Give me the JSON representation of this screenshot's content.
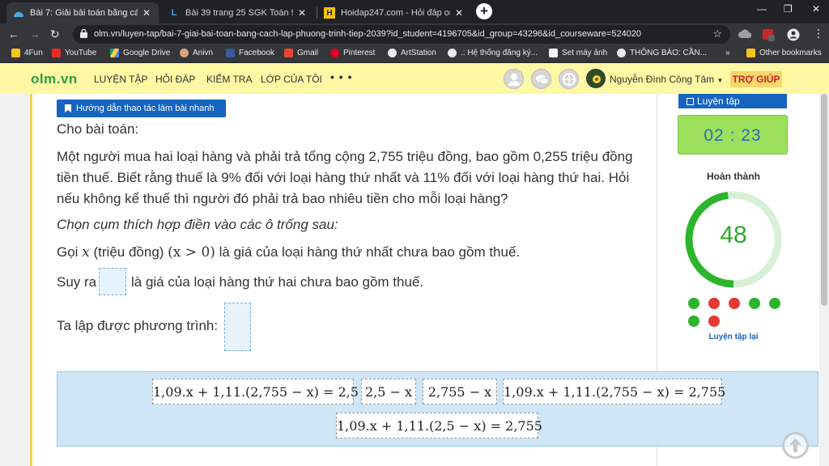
{
  "browser": {
    "tabs": [
      {
        "title": "Bài 7: Giải bài toán bằng cách lập",
        "active": true
      },
      {
        "title": "Bài 39 trang 25 SGK Toán 9 tập 2",
        "active": false
      },
      {
        "title": "Hoidap247.com - Hỏi đáp online",
        "active": false
      }
    ],
    "url": "olm.vn/luyen-tap/bai-7-giai-bai-toan-bang-cach-lap-phuong-trinh-tiep-2039?id_student=4196705&id_group=43296&id_courseware=524020",
    "bookmarks": [
      "4Fun",
      "YouTube",
      "Google Drive",
      "Anivn",
      "Facebook",
      "Gmail",
      "Pinterest",
      "ArtStation",
      ".: Hệ thống đăng ký...",
      "Set máy ảnh",
      "THÔNG BÁO: CẦN..."
    ],
    "bookmarks_more": "»",
    "other_bookmarks": "Other bookmarks"
  },
  "site": {
    "logo": "olm.vn",
    "nav": [
      "LUYỆN TẬP",
      "HỎI ĐÁP",
      "KIỂM TRA",
      "LỚP CỦA TÔI"
    ],
    "more": "• • •",
    "username": "Nguyễn Đình Công Tâm",
    "help": "TRỢ GIÚP"
  },
  "exercise": {
    "guide_button": "Hướng dẫn thao tác làm bài nhanh",
    "prompt": "Cho bài toán:",
    "problem": "Một người mua hai loại hàng và phải trả tổng cộng 2,755 triệu đồng, bao gồm 0,255 triệu đồng tiền thuế. Biết rằng thuế là 9% đối với loại hàng thứ nhất và 11% đối với loại hàng thứ hai. Hỏi nếu không kể thuế thì người đó phải trả bao nhiêu tiền cho mỗi loại hàng?",
    "instruction": "Chọn cụm thích hợp điền vào các ô trống sau:",
    "line1_a": "Gọi ",
    "line1_var": "x",
    "line1_b": " (triệu đồng) ",
    "line1_cond": "(x > 0)",
    "line1_c": " là giá của loại hàng thứ nhất chưa bao gồm thuế.",
    "line2_a": "Suy ra",
    "line2_b": "là giá của loại hàng thứ hai chưa bao gồm thuế.",
    "line3": "Ta lập được phương trình:"
  },
  "answer_bank": [
    "1,09.x + 1,11.(2,755 − x) = 2,5",
    "2,5 − x",
    "2,755 − x",
    "1,09.x + 1,11.(2,755 − x) = 2,755",
    "1,09.x + 1,11.(2,5 − x) = 2,755"
  ],
  "sidebar": {
    "practice_tab": "Luyện tập",
    "timer": "02 : 23",
    "complete_label": "Hoàn thành",
    "score": "48",
    "progress_fraction": 0.48,
    "results": [
      "correct",
      "wrong",
      "wrong",
      "correct",
      "correct",
      "correct",
      "wrong"
    ],
    "redo": "Luyện tập lại",
    "colors": {
      "correct": "#2cb52c",
      "wrong": "#e53935"
    }
  }
}
